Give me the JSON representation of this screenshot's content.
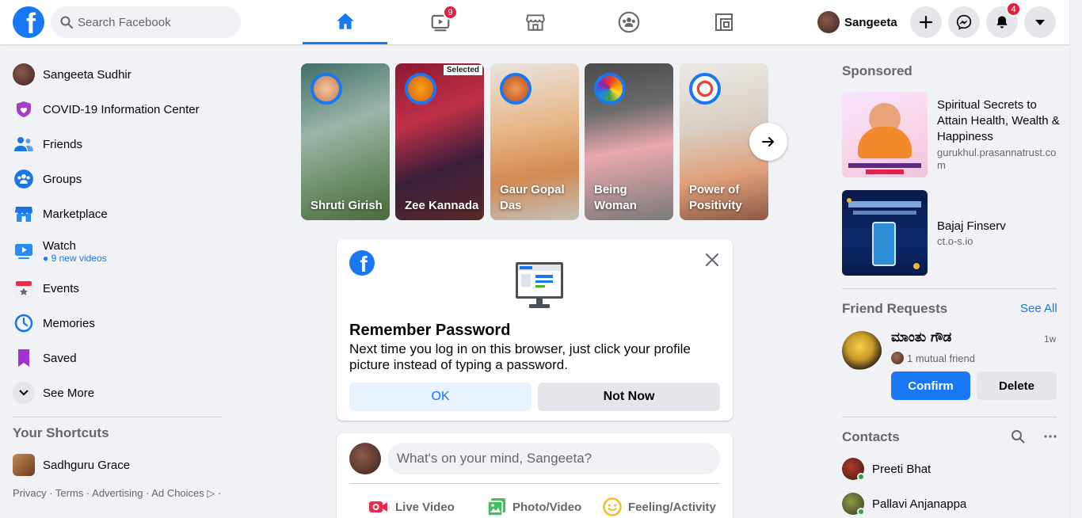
{
  "header": {
    "search_placeholder": "Search Facebook",
    "watch_badge": "9",
    "profile_name": "Sangeeta",
    "notifications_badge": "4",
    "accent_color": "#1877f2"
  },
  "sidebar": {
    "items": [
      {
        "label": "Sangeeta Sudhir"
      },
      {
        "label": "COVID-19 Information Center"
      },
      {
        "label": "Friends"
      },
      {
        "label": "Groups"
      },
      {
        "label": "Marketplace"
      },
      {
        "label": "Watch",
        "sub": "9 new videos"
      },
      {
        "label": "Events"
      },
      {
        "label": "Memories"
      },
      {
        "label": "Saved"
      },
      {
        "label": "See More"
      }
    ],
    "shortcuts_heading": "Your Shortcuts",
    "shortcuts": [
      {
        "label": "Sadhguru Grace"
      }
    ],
    "footer": "Privacy · Terms · Advertising · Ad Choices ▷ ·"
  },
  "stories": [
    {
      "name": "Shruti Girish"
    },
    {
      "name": "Zee Kannada",
      "tag": "Selected"
    },
    {
      "name": "Gaur Gopal Das"
    },
    {
      "name": "Being Woman"
    },
    {
      "name": "Power of Positivity"
    }
  ],
  "remember_password": {
    "title": "Remember Password",
    "body": "Next time you log in on this browser, just click your profile picture instead of typing a password.",
    "ok_label": "OK",
    "not_now_label": "Not Now"
  },
  "composer": {
    "placeholder": "What's on your mind, Sangeeta?",
    "actions": [
      "Live Video",
      "Photo/Video",
      "Feeling/Activity"
    ]
  },
  "right": {
    "sponsored_heading": "Sponsored",
    "ads": [
      {
        "title": "Spiritual Secrets to Attain Health, Wealth & Happiness",
        "source": "gurukhul.prasannatrust.com"
      },
      {
        "title": "Bajaj Finserv",
        "source": "ct.o-s.io"
      }
    ],
    "friend_requests_heading": "Friend Requests",
    "see_all": "See All",
    "request": {
      "name": "ಮಾಂತು ಗೌಡ",
      "time": "1w",
      "mutual": "1 mutual friend",
      "confirm": "Confirm",
      "delete": "Delete"
    },
    "contacts_heading": "Contacts",
    "contacts": [
      {
        "name": "Preeti Bhat"
      },
      {
        "name": "Pallavi Anjanappa"
      }
    ]
  }
}
